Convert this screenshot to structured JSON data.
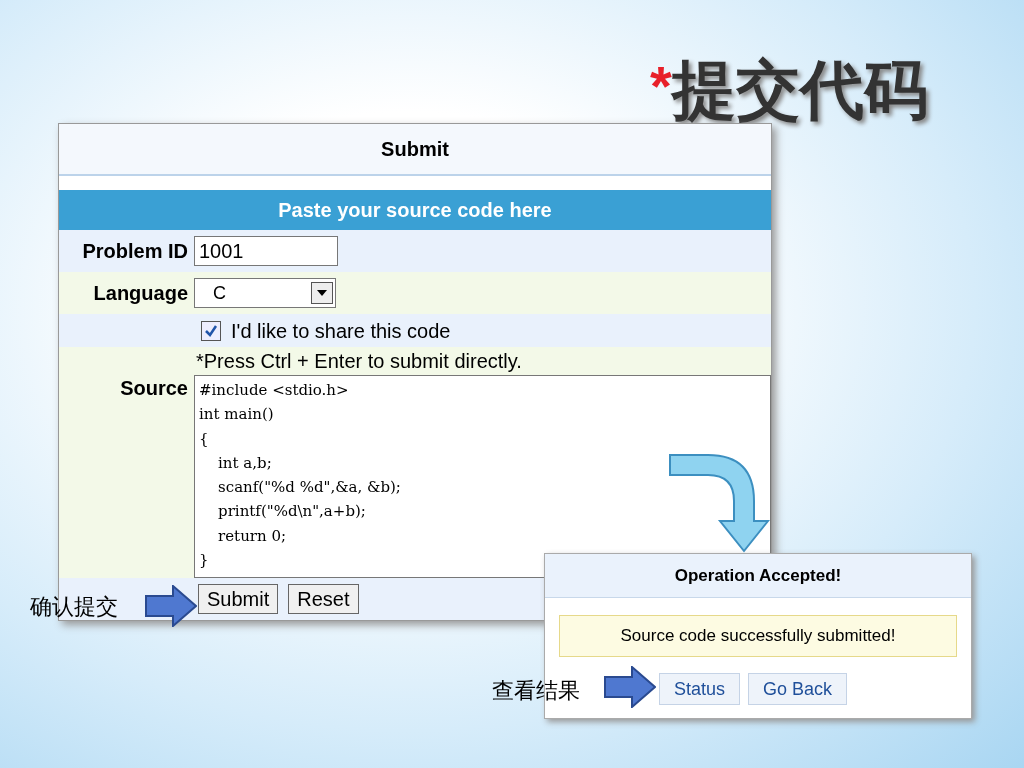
{
  "title": {
    "mark": "*",
    "text": "提交代码"
  },
  "submit_form": {
    "header": "Submit",
    "banner": "Paste your source code here",
    "problem_id": {
      "label": "Problem ID",
      "value": "1001"
    },
    "language": {
      "label": "Language",
      "value": "C"
    },
    "share": {
      "label": "I'd like to share this code",
      "checked": true
    },
    "hint": "*Press Ctrl + Enter to submit directly.",
    "source": {
      "label": "Source",
      "lines": [
        "#include <stdio.h>",
        "int main()",
        "{",
        "    int a,b;",
        "    scanf(\"%d %d\",&a, &b);",
        "    printf(\"%d\\n\",a+b);",
        "    return 0;",
        "}"
      ]
    },
    "buttons": [
      "Submit",
      "Reset"
    ]
  },
  "callouts": [
    {
      "text": "确认提交"
    },
    {
      "text": "查看结果"
    }
  ],
  "result_dialog": {
    "title": "Operation Accepted!",
    "message": "Source code successfully submitted!",
    "buttons": [
      "Status",
      "Go Back"
    ]
  }
}
